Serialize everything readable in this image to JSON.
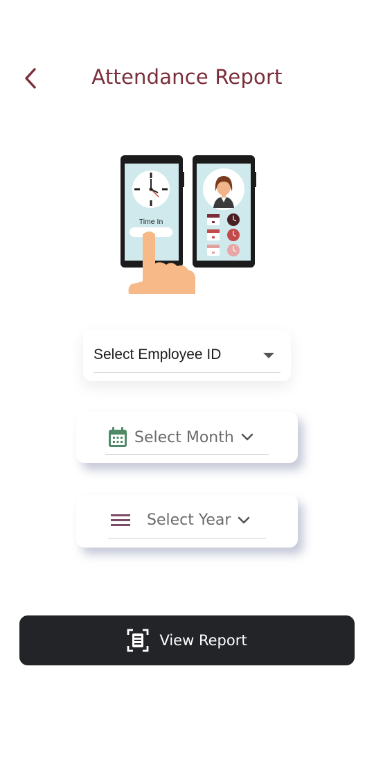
{
  "header": {
    "title": "Attendance Report",
    "back_icon": "chevron-left-icon"
  },
  "illustration": {
    "time_in_label": "Time In"
  },
  "employee_select": {
    "label": "Select Employee ID",
    "icon": "caret-down-icon"
  },
  "month_select": {
    "label": "Select Month",
    "icon": "calendar-icon",
    "chevron": "chevron-down-icon"
  },
  "year_select": {
    "label": "Select Year",
    "icon": "list-lines-icon",
    "chevron": "chevron-down-icon"
  },
  "view_button": {
    "label": "View Report",
    "icon": "document-scan-icon"
  },
  "colors": {
    "title": "#7a2e3a",
    "calendar": "#4f8a66",
    "year_icon": "#7b4a66",
    "button_bg": "#232428"
  }
}
